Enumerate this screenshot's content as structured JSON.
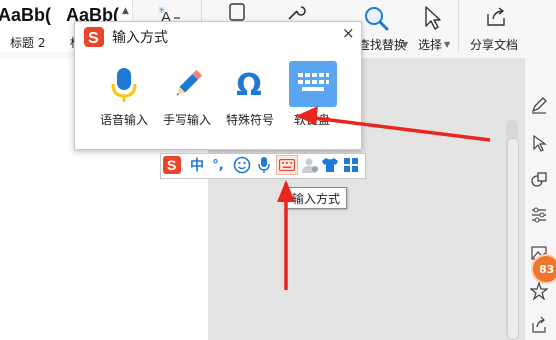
{
  "ribbon": {
    "style_tiles": [
      {
        "sample": "AaBb(",
        "name": "标题 2"
      },
      {
        "sample": "AaBb(",
        "name": "标"
      }
    ],
    "find_replace_label": "查找替换",
    "select_label": "选择",
    "share_label": "分享文档"
  },
  "popup": {
    "title": "输入方式",
    "close": "×",
    "items": [
      {
        "label": "语音输入",
        "icon": "microphone-icon"
      },
      {
        "label": "手写输入",
        "icon": "pencil-icon"
      },
      {
        "label": "特殊符号",
        "icon": "omega-icon"
      },
      {
        "label": "软键盘",
        "icon": "keyboard-icon"
      }
    ]
  },
  "toolbar": {
    "lang": "中",
    "punct": "°,",
    "tooltip": "输入方式"
  },
  "side": {
    "badge": "83"
  },
  "colors": {
    "sogou_red": "#e8452c",
    "accent_blue": "#1f7ad6",
    "mic_yellow": "#f5c518",
    "keyboard_tile": "#5aa6f2",
    "arrow_red": "#e8261e",
    "badge_orange": "#f0762b"
  }
}
